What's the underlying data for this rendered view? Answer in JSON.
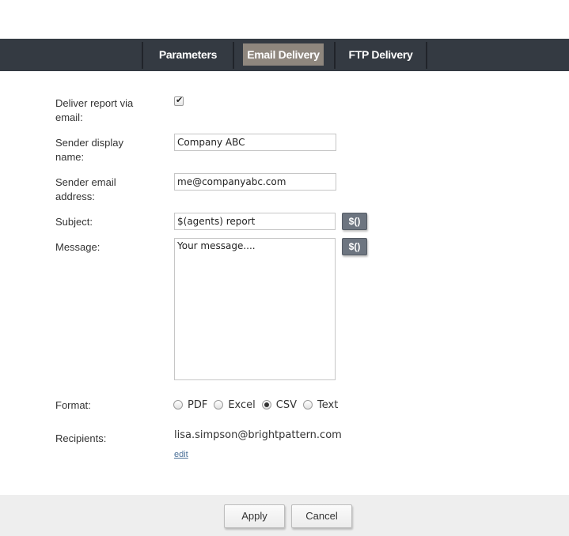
{
  "tabs": [
    {
      "label": "Parameters",
      "active": false
    },
    {
      "label": "Email Delivery",
      "active": true
    },
    {
      "label": "FTP Delivery",
      "active": false
    }
  ],
  "form": {
    "deliver_label": "Deliver report via email:",
    "deliver_checked": true,
    "sender_name_label": "Sender display name:",
    "sender_name_value": "Company ABC",
    "sender_email_label": "Sender email address:",
    "sender_email_value": "me@companyabc.com",
    "subject_label": "Subject:",
    "subject_value": "$(agents) report",
    "message_label": "Message:",
    "message_value": "Your message....",
    "variable_button_label": "$()",
    "format_label": "Format:",
    "format_options": [
      "PDF",
      "Excel",
      "CSV",
      "Text"
    ],
    "format_selected": "CSV",
    "recipients_label": "Recipients:",
    "recipients_value": "lisa.simpson@brightpattern.com",
    "edit_label": "edit"
  },
  "footer": {
    "apply_label": "Apply",
    "cancel_label": "Cancel"
  },
  "colors": {
    "tabbar_bg": "#343a42",
    "active_tab_bg": "#8f877e",
    "variable_button_bg": "#6d7580",
    "link": "#4a6f97",
    "footer_bg": "#eeeeee"
  },
  "icons": {
    "checkbox_check": "check-icon"
  }
}
